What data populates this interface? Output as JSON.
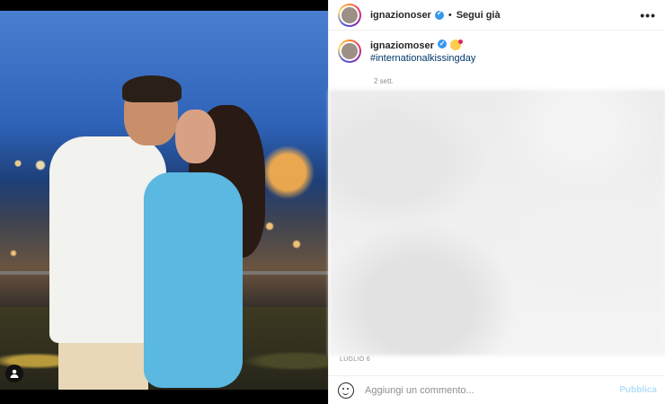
{
  "post": {
    "username": "ignazionoser",
    "follow_label": "Segui già",
    "dot": "•",
    "more_label": "•••",
    "caption_user": "ignaziomoser",
    "hashtag": "#internationalkissingday",
    "relative_time": "2 sett.",
    "date": "LUGLIO 6"
  },
  "comment": {
    "placeholder": "Aggiungi un commento...",
    "publish_label": "Pubblica"
  },
  "colors": {
    "verified": "#3897f0",
    "hashtag": "#00376b",
    "publish_disabled": "#b2dffc"
  },
  "icons": {
    "verified": "verified-badge-icon",
    "emoji": "kiss-emoji-icon",
    "tag": "user-tag-icon",
    "smile": "emoji-smile-icon",
    "more": "more-options-icon"
  }
}
